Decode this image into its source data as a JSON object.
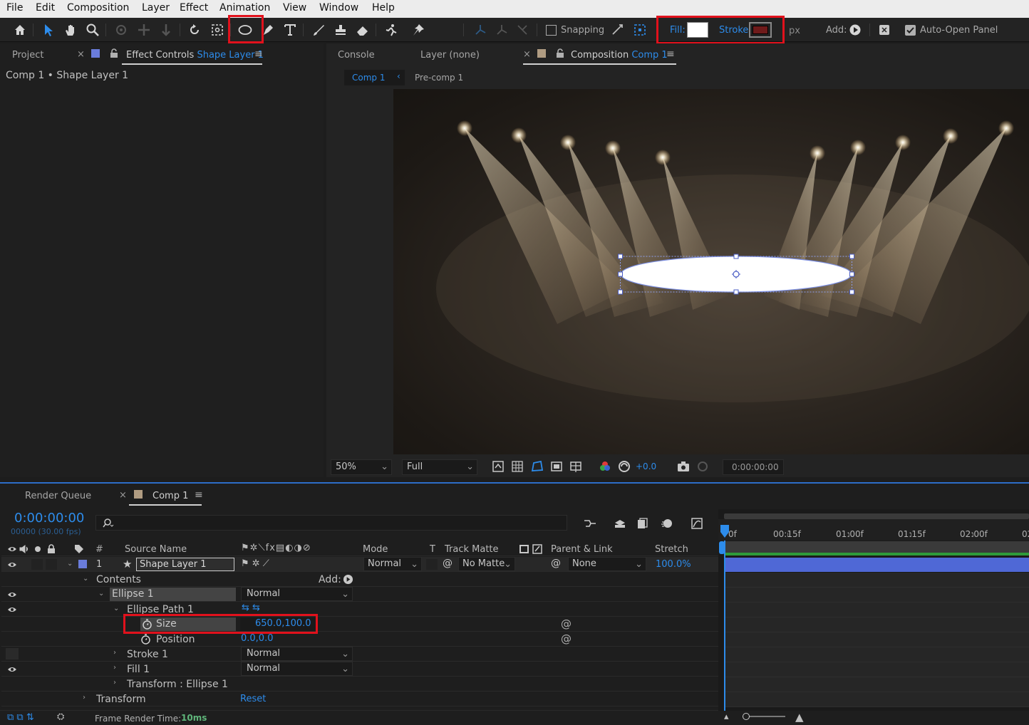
{
  "menu": [
    "File",
    "Edit",
    "Composition",
    "Layer",
    "Effect",
    "Animation",
    "View",
    "Window",
    "Help"
  ],
  "toolbar": {
    "snapping": "Snapping",
    "fill": "Fill:",
    "stroke": "Stroke:",
    "px": "px",
    "add": "Add:",
    "auto_open": "Auto-Open Panel",
    "fill_color": "#ffffff",
    "stroke_color": "#6e1a1a"
  },
  "left_panel": {
    "tab_project": "Project",
    "tab_effect_prefix": "Effect Controls",
    "tab_effect_layer": "Shape Layer 1",
    "breadcrumb": "Comp 1 • Shape Layer 1"
  },
  "viewer": {
    "tab_console": "Console",
    "tab_layer": "Layer (none)",
    "tab_composition": "Composition",
    "tab_comp_name": "Comp 1",
    "nav_comp1": "Comp 1",
    "nav_precomp": "Pre-comp 1",
    "zoom": "50%",
    "resolution": "Full",
    "exposure": "+0.0",
    "timecode": "0:00:00:00"
  },
  "timeline_panel": {
    "tab_render_queue": "Render Queue",
    "tab_comp": "Comp 1",
    "timecode": "0:00:00:00",
    "frames": "00000 (30.00 fps)",
    "col_num": "#",
    "col_source": "Source Name",
    "col_mode": "Mode",
    "col_t": "T",
    "col_track_matte": "Track Matte",
    "col_parent": "Parent & Link",
    "col_stretch": "Stretch",
    "layer": {
      "num": "1",
      "name": "Shape Layer 1",
      "mode": "Normal",
      "matte": "No Matte",
      "parent": "None",
      "stretch": "100.0%"
    },
    "contents": "Contents",
    "add": "Add:",
    "ellipse": "Ellipse 1",
    "ellipse_mode": "Normal",
    "ellipse_path": "Ellipse Path 1",
    "size_label": "Size",
    "size_value": "650.0,100.0",
    "position_label": "Position",
    "position_value": "0.0,0.0",
    "stroke": "Stroke 1",
    "stroke_mode": "Normal",
    "fill": "Fill 1",
    "fill_mode": "Normal",
    "transform_ellipse": "Transform : Ellipse 1",
    "transform": "Transform",
    "reset": "Reset",
    "frame_render_label": "Frame Render Time:",
    "frame_render_value": "10ms",
    "ruler": [
      "0f",
      "00:15f",
      "01:00f",
      "01:15f",
      "02:00f",
      "02"
    ]
  }
}
